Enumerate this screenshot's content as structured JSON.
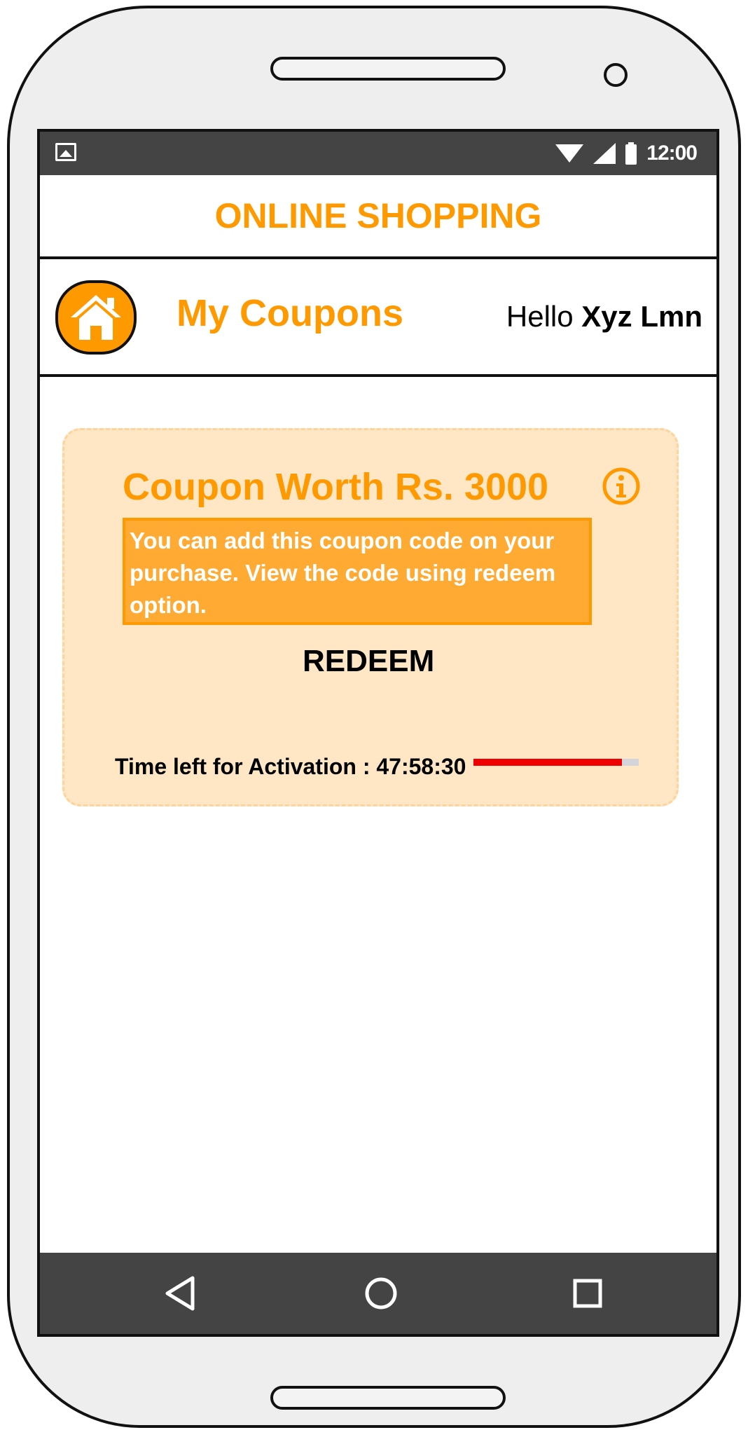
{
  "statusbar": {
    "time": "12:00",
    "icons": [
      "image-icon",
      "wifi-icon",
      "signal-icon",
      "battery-icon"
    ]
  },
  "app": {
    "title": "ONLINE SHOPPING"
  },
  "header": {
    "page_title": "My Coupons",
    "greeting_prefix": "Hello ",
    "user_name": "Xyz Lmn",
    "home_icon": "home-icon"
  },
  "coupon": {
    "title": "Coupon Worth Rs. 3000",
    "description": "You can add this coupon code on your purchase. View the code using redeem option.",
    "redeem_label": "REDEEM",
    "timer_label": "Time left for Activation : ",
    "timer_value": "47:58:30",
    "progress_fraction": 0.9,
    "info_icon": "info-icon"
  },
  "navbar": {
    "icons": [
      "back-icon",
      "home-circle-icon",
      "recent-apps-icon"
    ]
  },
  "colors": {
    "accent": "#ff9900",
    "coupon_bg": "#ffe6c4",
    "bar": "#444444",
    "progress": "#ee0000"
  }
}
